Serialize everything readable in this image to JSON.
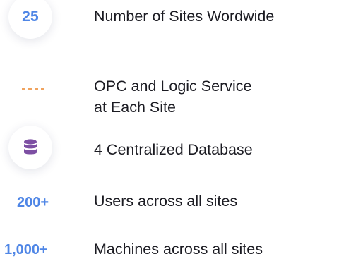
{
  "stats": [
    {
      "value": "25",
      "label": "Number of Sites Wordwide"
    },
    {
      "value": "",
      "label_lines": [
        "OPC and Logic Service",
        "at Each Site"
      ]
    },
    {
      "value": "",
      "label": "4 Centralized Database"
    },
    {
      "value": "200+",
      "label": "Users across all sites"
    },
    {
      "value": "1,000+",
      "label": "Machines across all sites"
    }
  ],
  "colors": {
    "accent_blue": "#4f86e6",
    "dash_orange": "#f0a35e",
    "database_purple": "#7d4fa3",
    "text": "#1b1b22"
  },
  "icons": {
    "row2": "dashed-line-icon",
    "row3": "database-icon"
  }
}
